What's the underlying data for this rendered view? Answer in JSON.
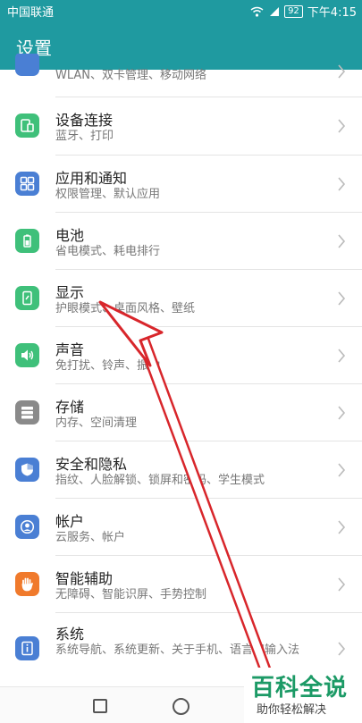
{
  "status": {
    "carrier": "中国联通",
    "battery": "92",
    "time": "下午4:15"
  },
  "header": {
    "title": "设置"
  },
  "items": [
    {
      "title": "",
      "sub": "WLAN、双卡管理、移动网络",
      "icon": "network-icon",
      "color": "#4a7fd4"
    },
    {
      "title": "设备连接",
      "sub": "蓝牙、打印",
      "icon": "device-connect-icon",
      "color": "#3fc07a"
    },
    {
      "title": "应用和通知",
      "sub": "权限管理、默认应用",
      "icon": "apps-icon",
      "color": "#4a7fd4"
    },
    {
      "title": "电池",
      "sub": "省电模式、耗电排行",
      "icon": "battery-icon",
      "color": "#3fc07a"
    },
    {
      "title": "显示",
      "sub": "护眼模式、桌面风格、壁纸",
      "icon": "display-icon",
      "color": "#3fc07a"
    },
    {
      "title": "声音",
      "sub": "免打扰、铃声、振动",
      "icon": "sound-icon",
      "color": "#3fc07a"
    },
    {
      "title": "存储",
      "sub": "内存、空间清理",
      "icon": "storage-icon",
      "color": "#8a8a8a"
    },
    {
      "title": "安全和隐私",
      "sub": "指纹、人脸解锁、锁屏和密码、学生模式",
      "icon": "shield-icon",
      "color": "#4a7fd4"
    },
    {
      "title": "帐户",
      "sub": "云服务、帐户",
      "icon": "account-icon",
      "color": "#4a7fd4"
    },
    {
      "title": "智能辅助",
      "sub": "无障碍、智能识屏、手势控制",
      "icon": "hand-icon",
      "color": "#f07a2c"
    },
    {
      "title": "系统",
      "sub": "系统导航、系统更新、关于手机、语言和输入法",
      "icon": "system-info-icon",
      "color": "#4a7fd4"
    }
  ],
  "watermark": {
    "logo": "百科全说",
    "tagline": "助你轻松解决"
  }
}
